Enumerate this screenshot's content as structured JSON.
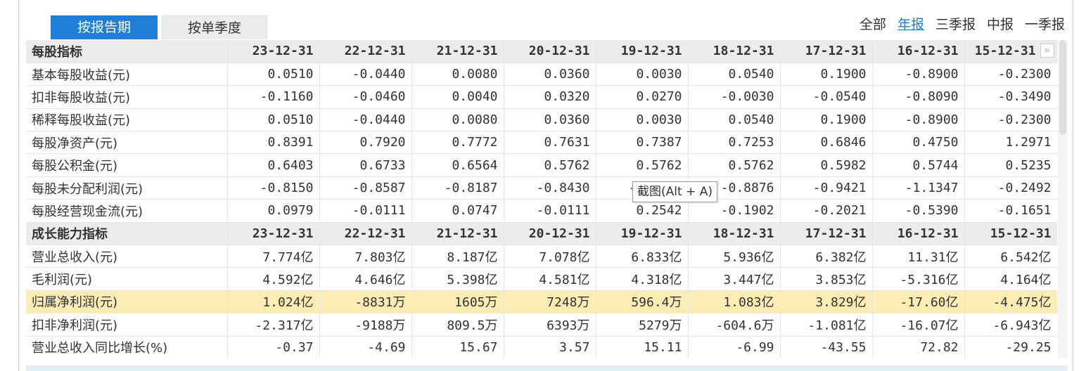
{
  "tabs": [
    {
      "label": "按报告期",
      "active": true
    },
    {
      "label": "按单季度",
      "active": false
    }
  ],
  "filters": [
    {
      "label": "全部",
      "selected": false
    },
    {
      "label": "年报",
      "selected": true
    },
    {
      "label": "三季报",
      "selected": false
    },
    {
      "label": "中报",
      "selected": false
    },
    {
      "label": "一季报",
      "selected": false
    }
  ],
  "tooltip": "截图(Alt + A)",
  "next_icon": "double-chevron-right-icon",
  "sections": [
    {
      "title": "每股指标",
      "periods": [
        "23-12-31",
        "22-12-31",
        "21-12-31",
        "20-12-31",
        "19-12-31",
        "18-12-31",
        "17-12-31",
        "16-12-31",
        "15-12-31"
      ],
      "rows": [
        {
          "label": "基本每股收益(元)",
          "values": [
            "0.0510",
            "-0.0440",
            "0.0080",
            "0.0360",
            "0.0030",
            "0.0540",
            "0.1900",
            "-0.8900",
            "-0.2300"
          ]
        },
        {
          "label": "扣非每股收益(元)",
          "values": [
            "-0.1160",
            "-0.0460",
            "0.0040",
            "0.0320",
            "0.0270",
            "-0.0030",
            "-0.0540",
            "-0.8090",
            "-0.3490"
          ]
        },
        {
          "label": "稀释每股收益(元)",
          "values": [
            "0.0510",
            "-0.0440",
            "0.0080",
            "0.0360",
            "0.0030",
            "0.0540",
            "0.1900",
            "-0.8900",
            "-0.2300"
          ]
        },
        {
          "label": "每股净资产(元)",
          "values": [
            "0.8391",
            "0.7920",
            "0.7772",
            "0.7631",
            "0.7387",
            "0.7253",
            "0.6846",
            "0.4750",
            "1.2971"
          ]
        },
        {
          "label": "每股公积金(元)",
          "values": [
            "0.6403",
            "0.6733",
            "0.6564",
            "0.5762",
            "0.5762",
            "0.5762",
            "0.5982",
            "0.5744",
            "0.5235"
          ]
        },
        {
          "label": "每股未分配利润(元)",
          "values": [
            "-0.8150",
            "-0.8587",
            "-0.8187",
            "-0.8430",
            "-0.8791",
            "-0.8876",
            "-0.9421",
            "-1.1347",
            "-0.2492"
          ]
        },
        {
          "label": "每股经营现金流(元)",
          "values": [
            "0.0979",
            "-0.0111",
            "0.0747",
            "-0.0111",
            "0.2542",
            "-0.1902",
            "-0.2021",
            "-0.5390",
            "-0.1651"
          ]
        }
      ]
    },
    {
      "title": "成长能力指标",
      "periods": [
        "23-12-31",
        "22-12-31",
        "21-12-31",
        "20-12-31",
        "19-12-31",
        "18-12-31",
        "17-12-31",
        "16-12-31",
        "15-12-31"
      ],
      "rows": [
        {
          "label": "营业总收入(元)",
          "values": [
            "7.774亿",
            "7.803亿",
            "8.187亿",
            "7.078亿",
            "6.833亿",
            "5.936亿",
            "6.382亿",
            "11.31亿",
            "6.542亿"
          ]
        },
        {
          "label": "毛利润(元)",
          "values": [
            "4.592亿",
            "4.646亿",
            "5.398亿",
            "4.581亿",
            "4.318亿",
            "3.447亿",
            "3.853亿",
            "-5.316亿",
            "4.164亿"
          ]
        },
        {
          "label": "归属净利润(元)",
          "values": [
            "1.024亿",
            "-8831万",
            "1605万",
            "7248万",
            "596.4万",
            "1.083亿",
            "3.829亿",
            "-17.60亿",
            "-4.475亿"
          ],
          "highlight": true
        },
        {
          "label": "扣非净利润(元)",
          "values": [
            "-2.317亿",
            "-9188万",
            "809.5万",
            "6393万",
            "5279万",
            "-604.6万",
            "-1.081亿",
            "-16.07亿",
            "-6.943亿"
          ]
        },
        {
          "label": "营业总收入同比增长(%)",
          "values": [
            "-0.37",
            "-4.69",
            "15.67",
            "3.57",
            "15.11",
            "-6.99",
            "-43.55",
            "72.82",
            "-29.25"
          ]
        }
      ]
    }
  ]
}
